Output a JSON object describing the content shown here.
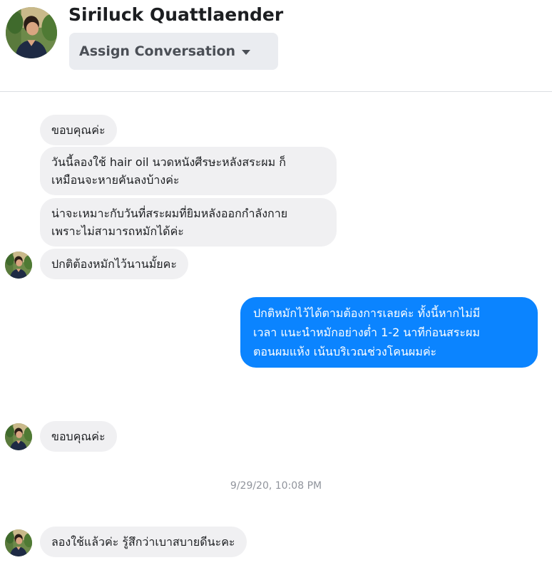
{
  "contact": {
    "name": "Siriluck Quattlaender",
    "assign_label": "Assign Conversation"
  },
  "messages": [
    {
      "direction": "incoming",
      "lines": [
        "ขอบคุณค่ะ"
      ]
    },
    {
      "direction": "incoming",
      "lines": [
        "วันนี้ลองใช้ hair oil นวดหนังศีรษะหลังสระผม ก็",
        "เหมือนจะหายคันลงบ้างค่ะ"
      ]
    },
    {
      "direction": "incoming",
      "lines": [
        "น่าจะเหมาะกับวันที่สระผมที่ยิมหลังออกกำลังกาย",
        "เพราะไม่สามารถหมักได้ค่ะ"
      ]
    },
    {
      "direction": "incoming",
      "lines": [
        "ปกติต้องหมักไว้นานมั้ยคะ"
      ]
    },
    {
      "direction": "outgoing",
      "lines": [
        "ปกติหมักไว้ได้ตามต้องการเลยค่ะ ทั้งนี้หากไม่มี",
        "เวลา แนะนำหมักอย่างต่ำ 1-2 นาทีก่อนสระผม",
        "ตอนผมแห้ง เน้นบริเวณช่วงโคนผมค่ะ"
      ]
    },
    {
      "direction": "incoming",
      "lines": [
        "ขอบคุณค่ะ"
      ]
    },
    {
      "direction": "incoming",
      "lines": [
        "ลองใช้แล้วค่ะ รู้สึกว่าเบาสบายดีนะคะ"
      ]
    }
  ],
  "timestamp": "9/29/20, 10:08 PM",
  "colors": {
    "outgoing_bubble": "#0b84ff",
    "incoming_bubble": "#f0f0f2"
  }
}
